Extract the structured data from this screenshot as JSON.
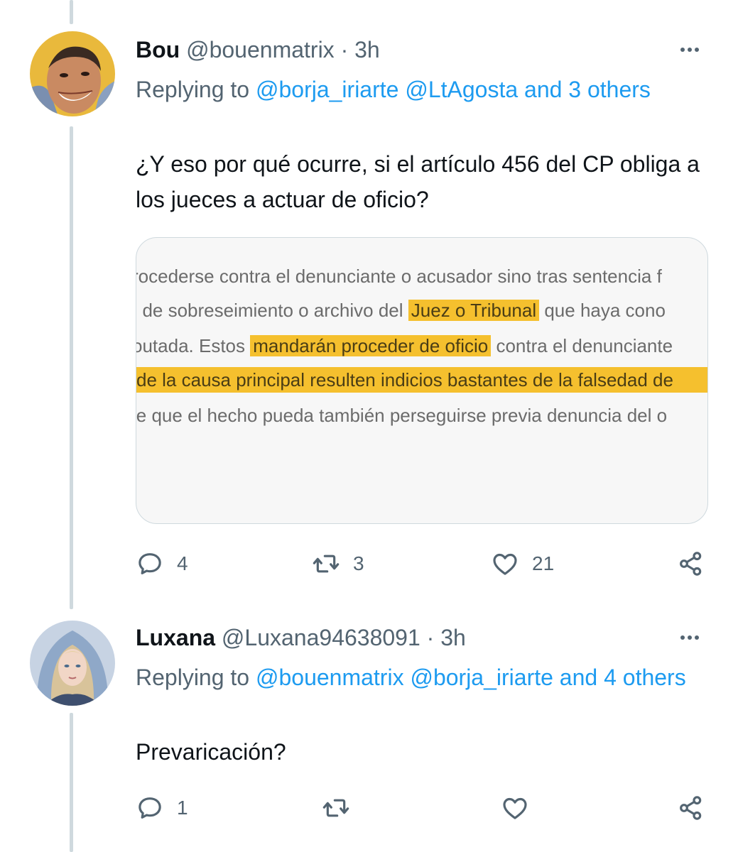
{
  "tweets": [
    {
      "name": "Bou",
      "handle": "@bouenmatrix",
      "dot": "·",
      "time": "3h",
      "replying_prefix": "Replying to",
      "mention1": "@borja_iriarte",
      "mention2": "@LtAgosta",
      "others": "and 3 others",
      "text": "¿Y eso por qué ocurre, si el artículo 456 del CP obliga a los jueces a actuar de oficio?",
      "media": {
        "line1": "rocederse contra el denunciante o acusador sino tras sentencia f",
        "line2_pre": ", de sobreseimiento o archivo del",
        "line2_hl": "Juez o Tribunal",
        "line2_post": "que haya cono",
        "line3_pre": "outada. Estos",
        "line3_hl": "mandarán proceder de oficio",
        "line3_post": "contra el denunciante",
        "line4_hl": "de la causa principal resulten indicios bastantes de la falsedad de",
        "line5": "le que el hecho pueda también perseguirse previa denuncia del o"
      },
      "replies": "4",
      "retweets": "3",
      "likes": "21"
    },
    {
      "name": "Luxana",
      "handle": "@Luxana94638091",
      "dot": "·",
      "time": "3h",
      "replying_prefix": "Replying to",
      "mention1": "@bouenmatrix",
      "mention2": "@borja_iriarte",
      "others": "and 4 others",
      "text": "Prevaricación?",
      "replies": "1"
    }
  ],
  "icons": {
    "reply": "reply-icon",
    "retweet": "retweet-icon",
    "like": "heart-icon",
    "share": "share-icon",
    "more": "more-icon"
  },
  "colors": {
    "accent": "#1d9bf0",
    "muted": "#536471",
    "highlight": "#f5c02e"
  }
}
